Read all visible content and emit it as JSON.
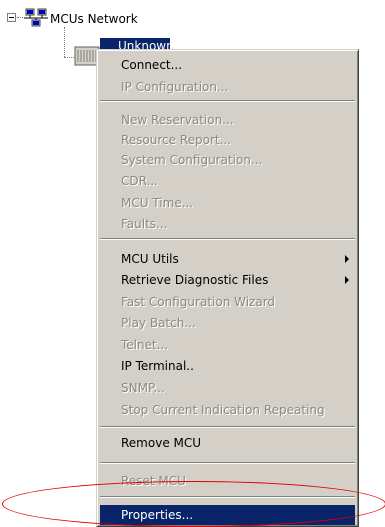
{
  "tree": {
    "root_label": "MCUs Network",
    "node_label": "Unknown"
  },
  "menu": {
    "groups": [
      [
        {
          "label": "Connect...",
          "enabled": true
        },
        {
          "label": "IP Configuration...",
          "enabled": false
        }
      ],
      [
        {
          "label": "New Reservation...",
          "enabled": false
        },
        {
          "label": "Resource Report...",
          "enabled": false
        },
        {
          "label": "System Configuration...",
          "enabled": false
        },
        {
          "label": "CDR...",
          "enabled": false
        },
        {
          "label": "MCU Time...",
          "enabled": false
        },
        {
          "label": "Faults...",
          "enabled": false
        }
      ],
      [
        {
          "label": "MCU Utils",
          "enabled": true,
          "submenu": true
        },
        {
          "label": "Retrieve Diagnostic Files",
          "enabled": true,
          "submenu": true
        },
        {
          "label": "Fast Configuration Wizard",
          "enabled": false
        },
        {
          "label": "Play Batch...",
          "enabled": false
        },
        {
          "label": "Telnet...",
          "enabled": false
        },
        {
          "label": "IP Terminal..",
          "enabled": true
        },
        {
          "label": "SNMP...",
          "enabled": false
        },
        {
          "label": "Stop Current Indication Repeating",
          "enabled": false
        }
      ],
      [
        {
          "label": "Remove MCU",
          "enabled": true
        }
      ],
      [
        {
          "label": "Reset MCU",
          "enabled": false
        }
      ],
      [
        {
          "label": "Properties...",
          "enabled": true,
          "highlighted": true
        }
      ]
    ]
  },
  "colors": {
    "menu_background": "#d4d0c8",
    "selection": "#0a246a",
    "disabled_text": "#8c8983",
    "annotation": "#e00000"
  }
}
